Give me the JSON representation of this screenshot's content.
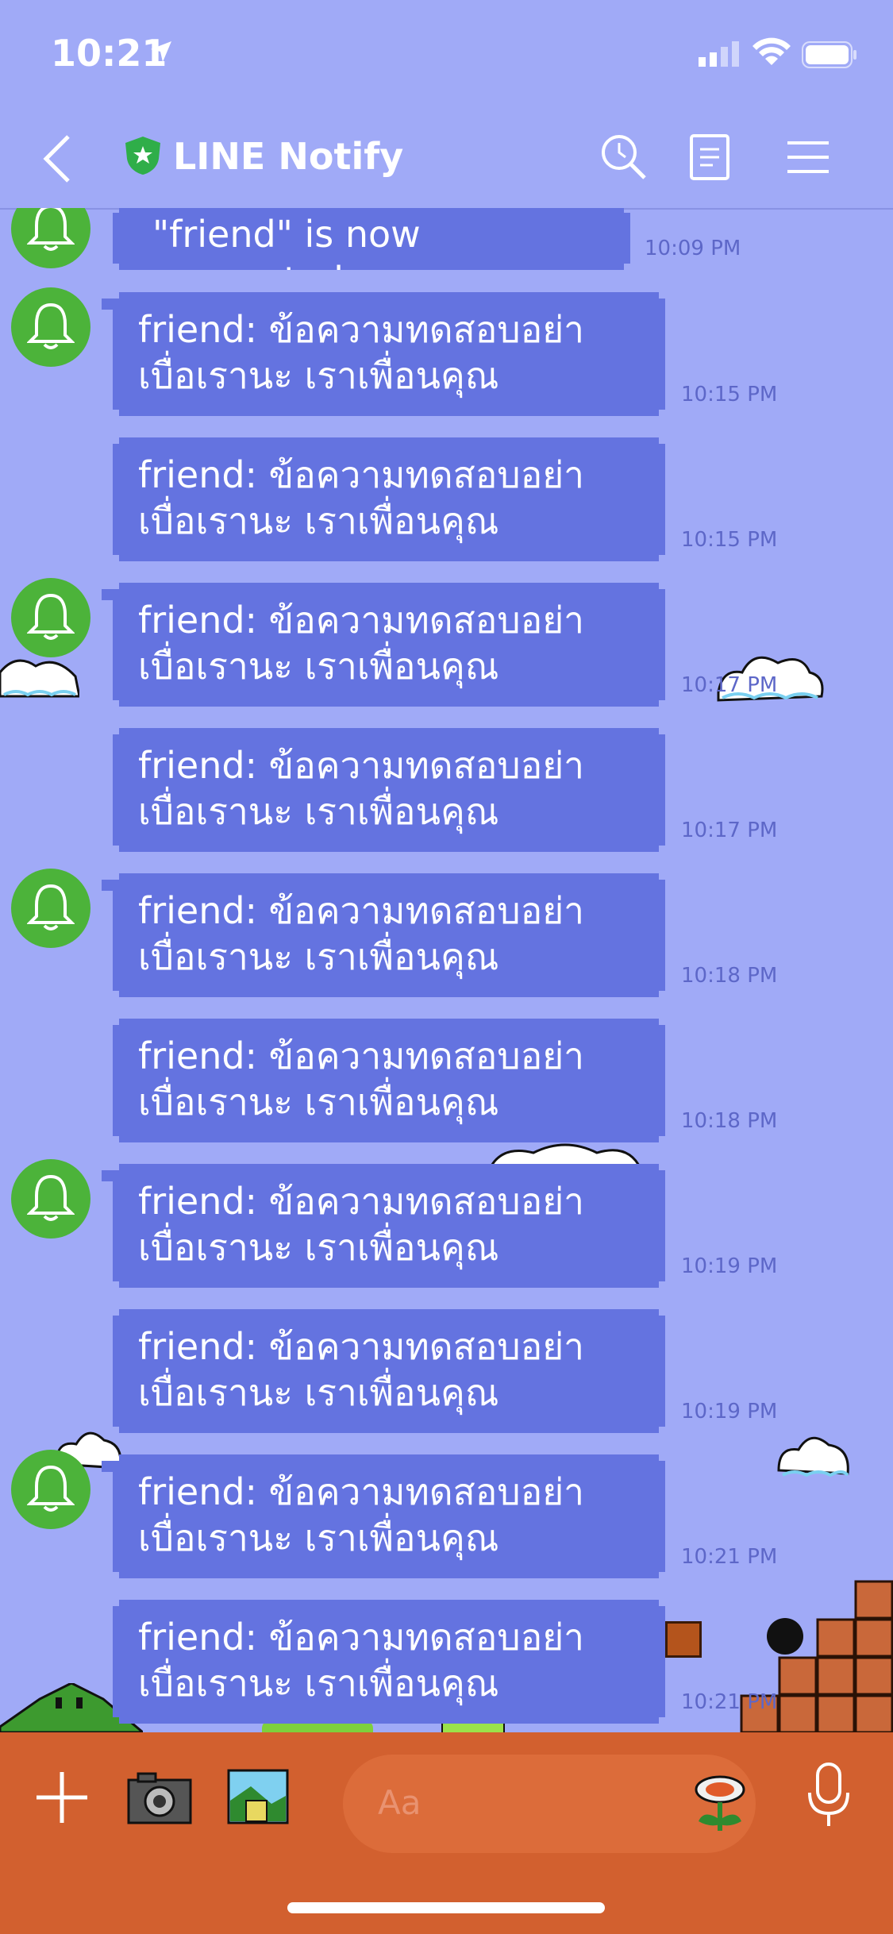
{
  "status_bar": {
    "time": "10:21"
  },
  "header": {
    "title": "LINE Notify"
  },
  "messages": [
    {
      "text": "\"friend\" is now connected.",
      "time": "10:09 PM",
      "avatar": true
    },
    {
      "text": "friend: ข้อความทดสอบอย่าเบื่อเรานะ เราเพื่อนคุณ",
      "time": "10:15 PM",
      "avatar": true
    },
    {
      "text": "friend: ข้อความทดสอบอย่าเบื่อเรานะ เราเพื่อนคุณ",
      "time": "10:15 PM",
      "avatar": false
    },
    {
      "text": "friend: ข้อความทดสอบอย่าเบื่อเรานะ เราเพื่อนคุณ",
      "time": "10:17 PM",
      "avatar": true
    },
    {
      "text": "friend: ข้อความทดสอบอย่าเบื่อเรานะ เราเพื่อนคุณ",
      "time": "10:17 PM",
      "avatar": false
    },
    {
      "text": "friend: ข้อความทดสอบอย่าเบื่อเรานะ เราเพื่อนคุณ",
      "time": "10:18 PM",
      "avatar": true
    },
    {
      "text": "friend: ข้อความทดสอบอย่าเบื่อเรานะ เราเพื่อนคุณ",
      "time": "10:18 PM",
      "avatar": false
    },
    {
      "text": "friend: ข้อความทดสอบอย่าเบื่อเรานะ เราเพื่อนคุณ",
      "time": "10:19 PM",
      "avatar": true
    },
    {
      "text": "friend: ข้อความทดสอบอย่าเบื่อเรานะ เราเพื่อนคุณ",
      "time": "10:19 PM",
      "avatar": false
    },
    {
      "text": "friend: ข้อความทดสอบอย่าเบื่อเรานะ เราเพื่อนคุณ",
      "time": "10:21 PM",
      "avatar": true
    },
    {
      "text": "friend: ข้อความทดสอบอย่าเบื่อเรานะ เราเพื่อนคุณ",
      "time": "10:21 PM",
      "avatar": false
    }
  ],
  "input": {
    "placeholder": "Aa"
  },
  "colors": {
    "background": "#a0aaf7",
    "bubble": "#6473e0",
    "avatar": "#4cb33a",
    "bottom_bar": "#d2602f"
  }
}
